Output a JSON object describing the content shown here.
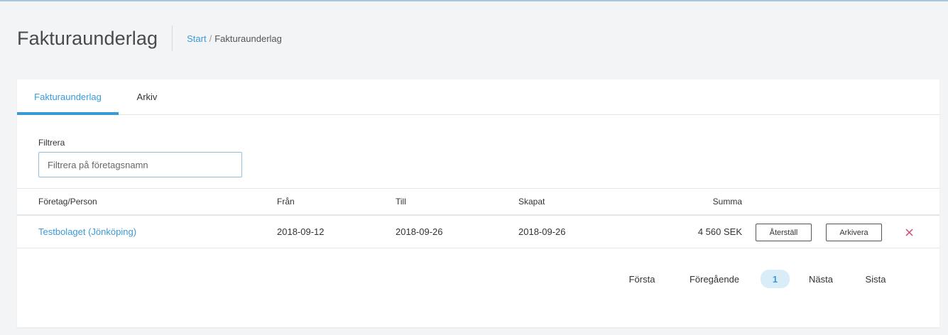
{
  "header": {
    "title": "Fakturaunderlag",
    "breadcrumb": {
      "home": "Start",
      "separator": "/",
      "current": "Fakturaunderlag"
    }
  },
  "tabs": [
    {
      "label": "Fakturaunderlag",
      "active": true
    },
    {
      "label": "Arkiv",
      "active": false
    }
  ],
  "filter": {
    "label": "Filtrera",
    "placeholder": "Filtrera på företagsnamn",
    "value": ""
  },
  "table": {
    "columns": {
      "name": "Företag/Person",
      "from": "Från",
      "to": "Till",
      "created": "Skapat",
      "sum": "Summa"
    },
    "rows": [
      {
        "name": "Testbolaget (Jönköping)",
        "from": "2018-09-12",
        "to": "2018-09-26",
        "created": "2018-09-26",
        "sum": "4 560 SEK",
        "restore_label": "Återställ",
        "archive_label": "Arkivera",
        "delete_icon": "close-icon"
      }
    ]
  },
  "pagination": {
    "first": "Första",
    "previous": "Föregående",
    "current": "1",
    "next": "Nästa",
    "last": "Sista"
  },
  "colors": {
    "accent": "#3a9ad9",
    "delete": "#d0486b",
    "background": "#f3f4f6"
  }
}
